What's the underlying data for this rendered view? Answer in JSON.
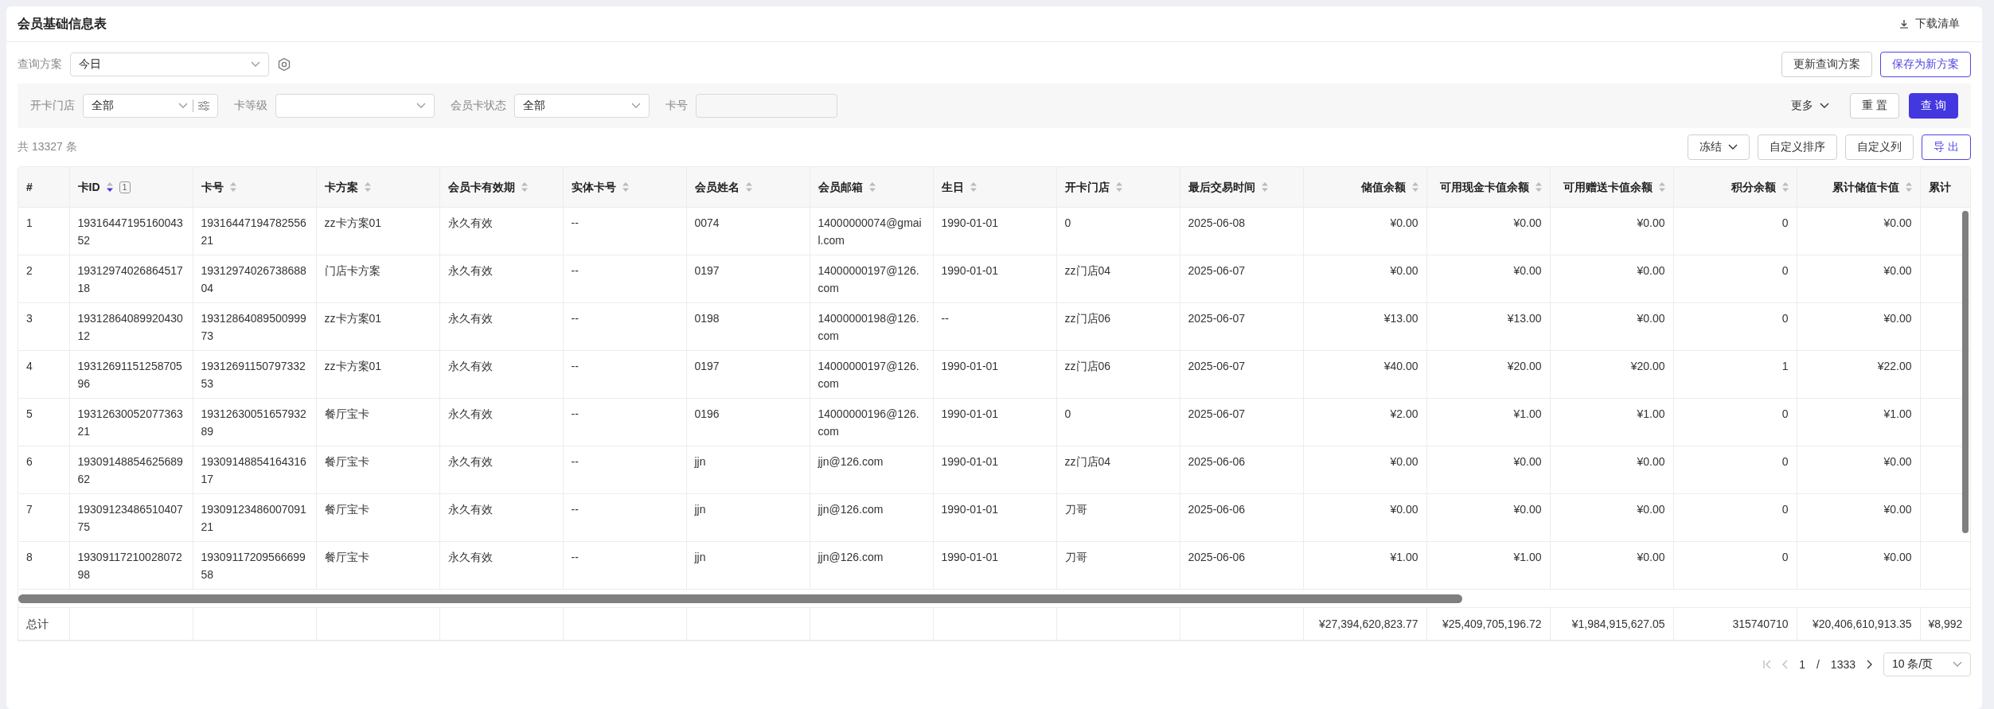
{
  "header": {
    "title": "会员基础信息表",
    "download": "下载清单"
  },
  "scheme": {
    "label": "查询方案",
    "value": "今日",
    "buttons": [
      {
        "label": "更新查询方案",
        "primary": false
      },
      {
        "label": "保存为新方案",
        "primary": true
      }
    ]
  },
  "filters": [
    {
      "kind": "select-advanced",
      "label": "开卡门店",
      "value": "全部"
    },
    {
      "kind": "select",
      "label": "卡等级"
    },
    {
      "kind": "select",
      "label": "会员卡状态",
      "value": "全部"
    },
    {
      "kind": "input",
      "label": "卡号"
    }
  ],
  "filter_actions": {
    "more": "更多",
    "reset": "重 置",
    "query": "查 询"
  },
  "summary": "共 13327 条",
  "toolbar": [
    {
      "kind": "dropdown",
      "label": "冻结",
      "primary": false
    },
    {
      "kind": "button",
      "label": "自定义排序",
      "primary": false
    },
    {
      "kind": "button",
      "label": "自定义列",
      "primary": false
    },
    {
      "kind": "button",
      "label": "导 出",
      "primary": true
    }
  ],
  "table": {
    "columns": [
      {
        "label": "#",
        "numeric": false,
        "sortable": false
      },
      {
        "label": "卡ID",
        "numeric": false,
        "sortable": true,
        "sorted": true,
        "badge": "1"
      },
      {
        "label": "卡号",
        "numeric": false,
        "sortable": true,
        "sorted": false
      },
      {
        "label": "卡方案",
        "numeric": false,
        "sortable": true,
        "sorted": false
      },
      {
        "label": "会员卡有效期",
        "numeric": false,
        "sortable": true,
        "sorted": false
      },
      {
        "label": "实体卡号",
        "numeric": false,
        "sortable": true,
        "sorted": false
      },
      {
        "label": "会员姓名",
        "numeric": false,
        "sortable": true,
        "sorted": false
      },
      {
        "label": "会员邮箱",
        "numeric": false,
        "sortable": true,
        "sorted": false
      },
      {
        "label": "生日",
        "numeric": false,
        "sortable": true,
        "sorted": false
      },
      {
        "label": "开卡门店",
        "numeric": false,
        "sortable": true,
        "sorted": false
      },
      {
        "label": "最后交易时间",
        "numeric": false,
        "sortable": true,
        "sorted": false
      },
      {
        "label": "储值余额",
        "numeric": true,
        "sortable": true,
        "sorted": false
      },
      {
        "label": "可用现金卡值余额",
        "numeric": true,
        "sortable": true,
        "sorted": false
      },
      {
        "label": "可用赠送卡值余额",
        "numeric": true,
        "sortable": true,
        "sorted": false
      },
      {
        "label": "积分余额",
        "numeric": true,
        "sortable": true,
        "sorted": false
      },
      {
        "label": "累计储值卡值",
        "numeric": true,
        "sortable": true,
        "sorted": false
      },
      {
        "label": "累计",
        "numeric": false,
        "sortable": false
      }
    ],
    "rows": [
      {
        "cells": [
          "1",
          "1931644719516004352",
          "1931644719478255621",
          "zz卡方案01",
          "永久有效",
          "--",
          "0074",
          "14000000074@gmail.com",
          "1990-01-01",
          "0",
          "2025-06-08",
          "¥0.00",
          "¥0.00",
          "¥0.00",
          "0",
          "¥0.00"
        ]
      },
      {
        "cells": [
          "2",
          "1931297402686451718",
          "1931297402673868804",
          "门店卡方案",
          "永久有效",
          "--",
          "0197",
          "14000000197@126.com",
          "1990-01-01",
          "zz门店04",
          "2025-06-07",
          "¥0.00",
          "¥0.00",
          "¥0.00",
          "0",
          "¥0.00"
        ]
      },
      {
        "cells": [
          "3",
          "1931286408992043012",
          "1931286408950099973",
          "zz卡方案01",
          "永久有效",
          "--",
          "0198",
          "14000000198@126.com",
          "--",
          "zz门店06",
          "2025-06-07",
          "¥13.00",
          "¥13.00",
          "¥0.00",
          "0",
          "¥0.00"
        ]
      },
      {
        "cells": [
          "4",
          "1931269115125870596",
          "1931269115079733253",
          "zz卡方案01",
          "永久有效",
          "--",
          "0197",
          "14000000197@126.com",
          "1990-01-01",
          "zz门店06",
          "2025-06-07",
          "¥40.00",
          "¥20.00",
          "¥20.00",
          "1",
          "¥22.00"
        ]
      },
      {
        "cells": [
          "5",
          "1931263005207736321",
          "1931263005165793289",
          "餐厅宝卡",
          "永久有效",
          "--",
          "0196",
          "14000000196@126.com",
          "1990-01-01",
          "0",
          "2025-06-07",
          "¥2.00",
          "¥1.00",
          "¥1.00",
          "0",
          "¥1.00"
        ]
      },
      {
        "cells": [
          "6",
          "1930914885462568962",
          "1930914885416431617",
          "餐厅宝卡",
          "永久有效",
          "--",
          "jjn",
          "jjn@126.com",
          "1990-01-01",
          "zz门店04",
          "2025-06-06",
          "¥0.00",
          "¥0.00",
          "¥0.00",
          "0",
          "¥0.00"
        ]
      },
      {
        "cells": [
          "7",
          "1930912348651040775",
          "1930912348600709121",
          "餐厅宝卡",
          "永久有效",
          "--",
          "jjn",
          "jjn@126.com",
          "1990-01-01",
          "刀哥",
          "2025-06-06",
          "¥0.00",
          "¥0.00",
          "¥0.00",
          "0",
          "¥0.00"
        ]
      },
      {
        "cells": [
          "8",
          "1930911721002807298",
          "1930911720956669958",
          "餐厅宝卡",
          "永久有效",
          "--",
          "jjn",
          "jjn@126.com",
          "1990-01-01",
          "刀哥",
          "2025-06-06",
          "¥1.00",
          "¥1.00",
          "¥0.00",
          "0",
          "¥0.00"
        ]
      }
    ],
    "totals": {
      "label": "总计",
      "values": [
        "¥27,394,620,823.77",
        "¥25,409,705,196.72",
        "¥1,984,915,627.05",
        "315740710",
        "¥20,406,610,913.35",
        "¥8,992"
      ]
    }
  },
  "pagination": {
    "page": "1",
    "separator": "/",
    "total": "1333",
    "page_size": "10 条/页"
  }
}
